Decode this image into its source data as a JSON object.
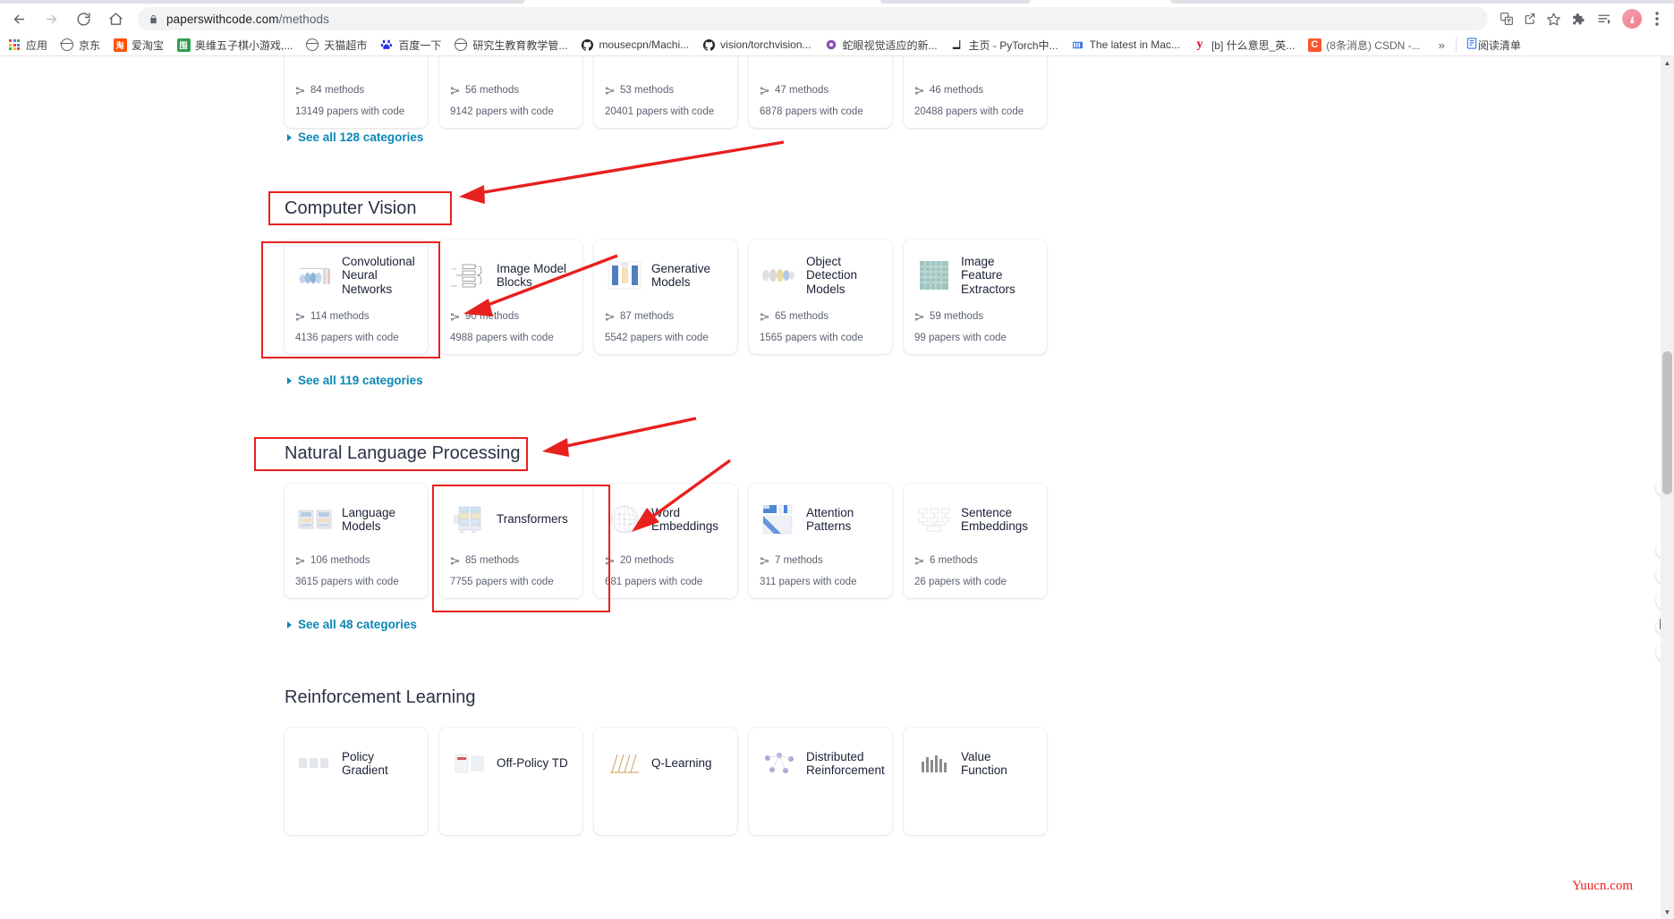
{
  "browser": {
    "back_icon": "back-arrow-icon",
    "forward_icon": "forward-arrow-icon",
    "reload_icon": "reload-icon",
    "home_icon": "home-icon",
    "url_host": "paperswithcode.com",
    "url_path": "/methods",
    "lock_icon": "lock-icon",
    "omnibox_icons": [
      "translate-icon",
      "share-icon",
      "bookmark-star-icon"
    ],
    "toolbar_icons": [
      "extensions-puzzle-icon",
      "reading-list-icon"
    ],
    "avatar_label": "",
    "menu_icon": "three-dot-menu-icon",
    "overflow_label": "»",
    "reading_list_label": "阅读清单",
    "reading_list_icon": "reading-list-icon"
  },
  "bookmarks": [
    {
      "label": "应用",
      "icon": "apps-grid-icon",
      "color": "#4285f4"
    },
    {
      "label": "京东",
      "icon": "globe-icon",
      "color": "#5f6368"
    },
    {
      "label": "爱淘宝",
      "icon": "taobao-icon",
      "color": "#ff5000"
    },
    {
      "label": "奥维五子棋小游戏,...",
      "icon": "game-icon",
      "color": "#2e9e4f"
    },
    {
      "label": "天猫超市",
      "icon": "globe-icon",
      "color": "#5f6368"
    },
    {
      "label": "百度一下",
      "icon": "baidu-icon",
      "color": "#2932e1"
    },
    {
      "label": "研究生教育教学管...",
      "icon": "globe-icon",
      "color": "#5f6368"
    },
    {
      "label": "mousecpn/Machi...",
      "icon": "github-icon",
      "color": "#24292e"
    },
    {
      "label": "vision/torchvision...",
      "icon": "github-icon",
      "color": "#24292e"
    },
    {
      "label": "蛇眼视觉适应的新...",
      "icon": "zhihu-icon",
      "color": "#8a4fb5"
    },
    {
      "label": "主页 - PyTorch中...",
      "icon": "book-icon",
      "color": "#1a1a1a"
    },
    {
      "label": "The latest in Mac...",
      "icon": "news-icon",
      "color": "#2f6fed"
    },
    {
      "label": "[b] 什么意思_英...",
      "icon": "yandex-icon",
      "color": "#e0002a"
    },
    {
      "label": "(8条消息) CSDN -...",
      "icon": "csdn-icon",
      "color": "#fc5531"
    }
  ],
  "page": {
    "top_row_cards": [
      {
        "methods": "84 methods",
        "papers": "13149 papers with code"
      },
      {
        "methods": "56 methods",
        "papers": "9142 papers with code"
      },
      {
        "methods": "53 methods",
        "papers": "20401 papers with code"
      },
      {
        "methods": "47 methods",
        "papers": "6878 papers with code"
      },
      {
        "methods": "46 methods",
        "papers": "20488 papers with code"
      }
    ],
    "see_all_general": "See all 128 categories",
    "sections": [
      {
        "title": "Computer Vision",
        "see_all": "See all 119 categories",
        "cards": [
          {
            "title": "Convolutional Neural Networks",
            "methods": "114 methods",
            "papers": "4136 papers with code",
            "thumb": "cnn-diagram-thumb"
          },
          {
            "title": "Image Model Blocks",
            "methods": "90 methods",
            "papers": "4988 papers with code",
            "thumb": "block-diagram-thumb"
          },
          {
            "title": "Generative Models",
            "methods": "87 methods",
            "papers": "5542 papers with code",
            "thumb": "gan-diagram-thumb"
          },
          {
            "title": "Object Detection Models",
            "methods": "65 methods",
            "papers": "1565 papers with code",
            "thumb": "detector-diagram-thumb"
          },
          {
            "title": "Image Feature Extractors",
            "methods": "59 methods",
            "papers": "99 papers with code",
            "thumb": "feature-grid-thumb"
          }
        ]
      },
      {
        "title": "Natural Language Processing",
        "see_all": "See all 48 categories",
        "cards": [
          {
            "title": "Language Models",
            "methods": "106 methods",
            "papers": "3615 papers with code",
            "thumb": "language-model-thumb"
          },
          {
            "title": "Transformers",
            "methods": "85 methods",
            "papers": "7755 papers with code",
            "thumb": "transformer-stack-thumb"
          },
          {
            "title": "Word Embeddings",
            "methods": "20 methods",
            "papers": "681 papers with code",
            "thumb": "sphere-embedding-thumb"
          },
          {
            "title": "Attention Patterns",
            "methods": "7 methods",
            "papers": "311 papers with code",
            "thumb": "attention-matrix-thumb"
          },
          {
            "title": "Sentence Embeddings",
            "methods": "6 methods",
            "papers": "26 papers with code",
            "thumb": "sentence-embedding-thumb"
          }
        ]
      },
      {
        "title": "Reinforcement Learning",
        "see_all": "",
        "cards": [
          {
            "title": "Policy Gradient",
            "methods": "",
            "papers": "",
            "thumb": "policy-gradient-thumb"
          },
          {
            "title": "Off-Policy TD",
            "methods": "",
            "papers": "",
            "thumb": "off-policy-thumb"
          },
          {
            "title": "Q-Learning",
            "methods": "",
            "papers": "",
            "thumb": "q-learning-thumb"
          },
          {
            "title": "Distributed Reinforcement",
            "methods": "",
            "papers": "",
            "thumb": "distributed-rl-thumb"
          },
          {
            "title": "Value Function",
            "methods": "",
            "papers": "",
            "thumb": "value-function-thumb"
          }
        ]
      }
    ]
  },
  "annotations": {
    "highlight_color": "#e8201e",
    "boxes": [
      "computer-vision-heading-box",
      "convolutional-neural-networks-card-box",
      "natural-language-processing-heading-box",
      "transformers-card-box"
    ],
    "arrows": [
      "arrow-to-computer-vision",
      "arrow-to-image-model-blocks",
      "arrow-to-natural-language-processing",
      "arrow-to-word-embeddings"
    ]
  },
  "watermark": "Yuucn.com"
}
